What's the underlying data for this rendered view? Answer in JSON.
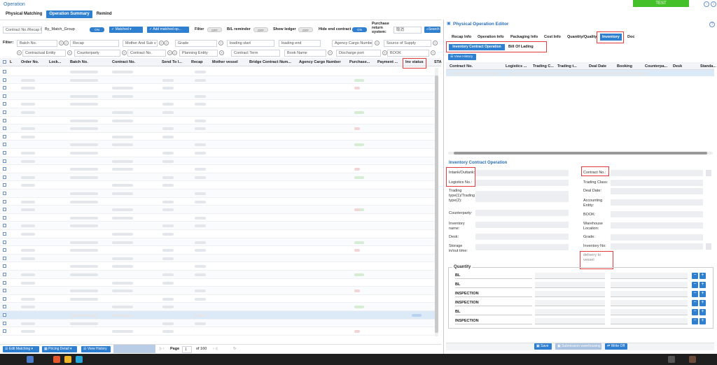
{
  "app": {
    "title": "Operation",
    "env_badge": "TEST"
  },
  "tabs": [
    {
      "label": "Physical Matching"
    },
    {
      "label": "Operation Summary"
    },
    {
      "label": "Remind"
    }
  ],
  "filters": {
    "contract_search_placeholder": "Contract No./Recap N",
    "by_match_group_label": "By_Match_Group",
    "by_match_group_toggle": "ON",
    "matched_btn": "Matched",
    "add_matched_btn": "Add matched op...",
    "filter_label": "Filter",
    "filter_toggle": "OFF",
    "bl_reminder_label": "B/L reminder",
    "bl_reminder_toggle": "OFF",
    "show_ledger_label": "Show ledger",
    "show_ledger_toggle": "OFF",
    "hide_end_contract_label": "Hide end contract",
    "hide_end_contract_toggle": "ON",
    "purchase_return_label": "Purchase return system:",
    "purchase_return_value": "取消",
    "search_btn": "Search",
    "filter_row_label": "Filter:",
    "row2": [
      "Batch No.",
      "Recap",
      "Mother And Sub v",
      "Grade",
      "loading start",
      "loading end",
      "Agency Cargo Numbe",
      "Source of Supply"
    ],
    "row3": [
      "Contractual Entity",
      "Counterparty",
      "Contract No.",
      "Planning Entity",
      "Contract Term",
      "Book Name",
      "Discharge port",
      "BOOK"
    ]
  },
  "grid": {
    "columns": [
      "L",
      "Order No.",
      "Lock...",
      "Batch No.",
      "Contract No.",
      "Send To I...",
      "Recap",
      "Mother vessel",
      "Bridge Contract Num...",
      "Agency Cargo Number",
      "Purchase...",
      "Payment ...",
      "Inv status",
      "STA"
    ]
  },
  "footer": {
    "edit_matching": "Edit Matching",
    "pricing_detail": "Pricing Detail",
    "view_history": "View History",
    "page_label": "Page",
    "page_value": "1",
    "page_total": "of 160"
  },
  "editor": {
    "title": "Physical Operation Editor",
    "tabs": [
      "Recap Info",
      "Operation Info",
      "Packaging Info",
      "Cost Info",
      "Quantity/Quality",
      "Inventory",
      "Doc"
    ],
    "subtabs": [
      "Inventory Contract Operation",
      "Bill Of Lading"
    ],
    "view_history": "View History",
    "columns": [
      "Contract No.",
      "Logistics ...",
      "Trading C...",
      "Trading t...",
      "Deal Date",
      "Booking",
      "Counterpa...",
      "Desk",
      "Standa..."
    ],
    "section_title": "Inventory Contract Operation",
    "left_fields": [
      "Intank/Outtank:",
      "Logistics No.:",
      "Trading type(1)/Trading type(2):",
      "Counterparty:",
      "Inventory name:",
      "Desk:",
      "Storage in/out time:"
    ],
    "right_fields": [
      "Contract No.:",
      "Trading Class:",
      "Deal Date:",
      "Accounting Entity:",
      "BOOK:",
      "Warehouse Location:",
      "Grade:",
      "Inventory No:"
    ],
    "delivery_placeholder": "delivery to vessel",
    "quantity_label": "Quantity",
    "quantity_rows": [
      "BL",
      "BL",
      "INSPECTION",
      "INSPECTION",
      "BL",
      "INSPECTION"
    ],
    "save_btn": "Save",
    "submission_btn": "Submission warehousing",
    "write_off_btn": "Write Off"
  },
  "colors": {
    "accent": "#2f7fd0",
    "badge": "#43c02a",
    "highlight": "#e23b3b"
  }
}
